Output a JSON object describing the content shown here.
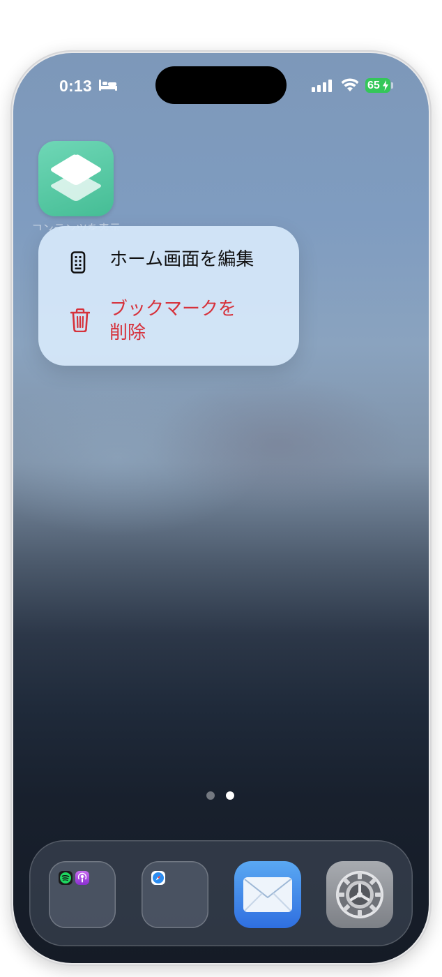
{
  "status_bar": {
    "time": "0:13",
    "battery_level": "65",
    "accent_battery": "#34c759"
  },
  "home": {
    "app_label": "コンテンツを表示"
  },
  "context_menu": {
    "edit_home_label": "ホーム画面を編集",
    "delete_bookmark_label": "ブックマークを削除",
    "destructive_color": "#d6313b"
  },
  "page_indicator": {
    "pages": 2,
    "current": 2
  },
  "dock": {
    "items": [
      "music-folder",
      "browser-folder",
      "mail-icon",
      "settings-icon"
    ]
  }
}
